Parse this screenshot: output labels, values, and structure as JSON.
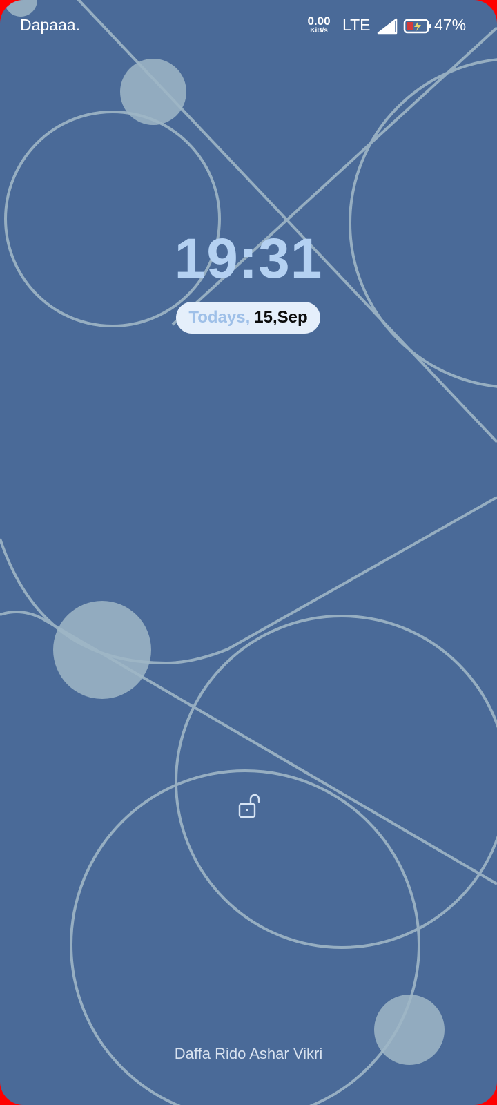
{
  "status_bar": {
    "carrier": "Dapaaa.",
    "speed_value": "0.00",
    "speed_unit": "KiB/s",
    "network": "LTE",
    "battery_percent": "47%",
    "icons": [
      "signal-icon",
      "battery-charging-icon"
    ]
  },
  "lockscreen": {
    "time": "19:31",
    "date_prefix": "Todays,",
    "date_value": "15,Sep",
    "lock_icon": "unlock-icon",
    "owner_info": "Daffa Rido Ashar Vikri"
  },
  "colors": {
    "background": "#4a6a98",
    "accent": "#b4d1f2",
    "frame": "#ff0000"
  }
}
